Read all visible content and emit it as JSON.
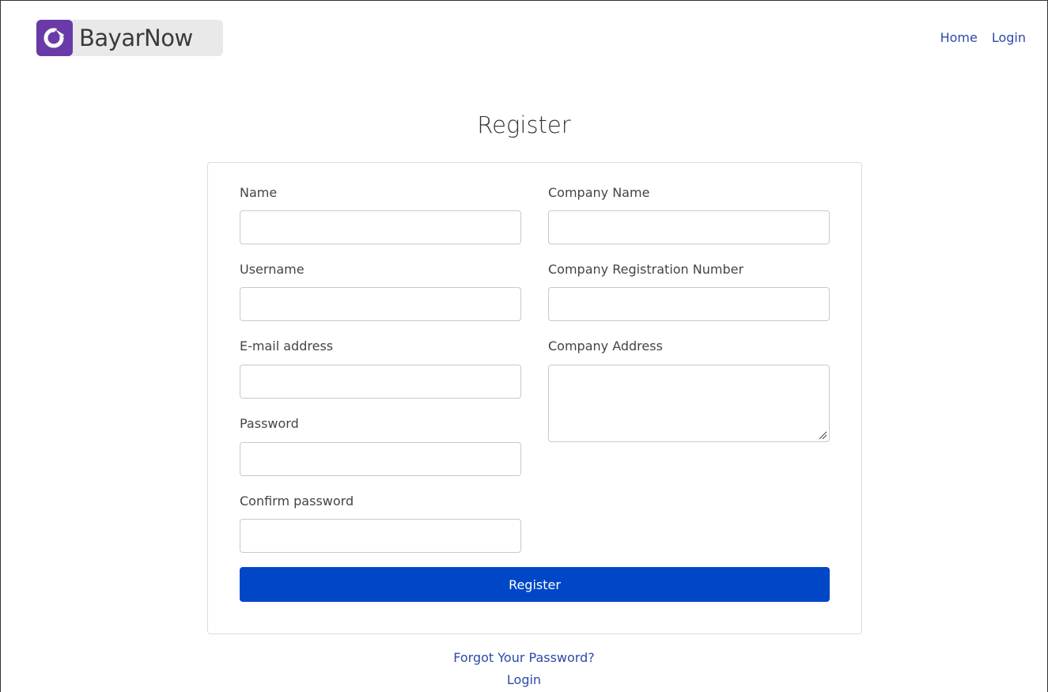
{
  "brand": {
    "name": "BayarNow",
    "accent": "#6a3aa8"
  },
  "nav": {
    "home": "Home",
    "login": "Login"
  },
  "page": {
    "title": "Register"
  },
  "form": {
    "name": {
      "label": "Name",
      "value": ""
    },
    "username": {
      "label": "Username",
      "value": ""
    },
    "email": {
      "label": "E-mail address",
      "value": ""
    },
    "password": {
      "label": "Password",
      "value": ""
    },
    "confirm_password": {
      "label": "Confirm password",
      "value": ""
    },
    "company_name": {
      "label": "Company Name",
      "value": ""
    },
    "company_reg_no": {
      "label": "Company Registration Number",
      "value": ""
    },
    "company_address": {
      "label": "Company Address",
      "value": ""
    },
    "submit_label": "Register",
    "submit_color": "#0047c8"
  },
  "links": {
    "forgot_password": "Forgot Your Password?",
    "login": "Login"
  }
}
